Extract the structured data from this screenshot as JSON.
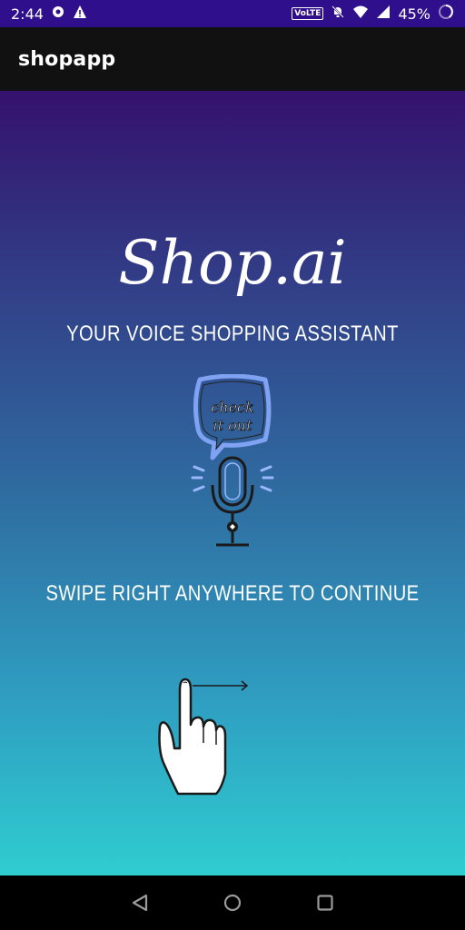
{
  "status_bar": {
    "time": "2:44",
    "volte": "VoLTE",
    "battery_percent": "45%"
  },
  "app_bar": {
    "title": "shopapp"
  },
  "splash": {
    "logo_text": "Shop.ai",
    "tagline": "YOUR VOICE SHOPPING ASSISTANT",
    "bubble_text_line1": "check",
    "bubble_text_line2": "it out",
    "swipe_hint": "SWIPE RIGHT ANYWHERE TO CONTINUE"
  },
  "icons": {
    "nav_back": "back-triangle-icon",
    "nav_home": "home-circle-icon",
    "nav_recents": "recents-square-icon"
  }
}
